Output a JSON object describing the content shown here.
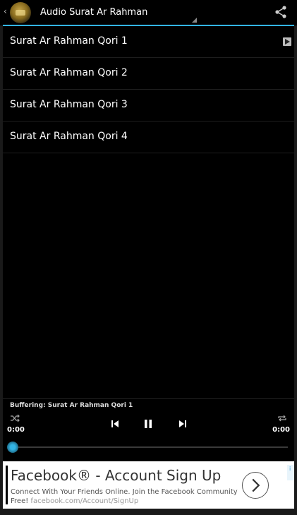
{
  "app": {
    "title": "Audio Surat Ar Rahman",
    "up_glyph": "‹",
    "icons": {
      "logo": "app-logo-icon",
      "share": "share-icon"
    },
    "accent": "#33b5e5"
  },
  "list": {
    "items": [
      {
        "label": "Surat Ar Rahman Qori 1",
        "playing": true
      },
      {
        "label": "Surat Ar Rahman Qori 2",
        "playing": false
      },
      {
        "label": "Surat Ar Rahman Qori 3",
        "playing": false
      },
      {
        "label": "Surat Ar Rahman Qori 4",
        "playing": false
      }
    ]
  },
  "player": {
    "status": "Buffering: Surat Ar Rahman Qori 1",
    "elapsed": "0:00",
    "duration": "0:00",
    "progress": 0,
    "icons": {
      "shuffle": "shuffle-icon",
      "previous": "skip-previous-icon",
      "pause": "pause-icon",
      "next": "skip-next-icon",
      "repeat": "repeat-icon"
    }
  },
  "ad": {
    "headline": "Facebook® - Account Sign Up",
    "body": "Connect With Your Friends Online. Join the Facebook Community Free!",
    "url": "facebook.com/Account/SignUp",
    "icons": {
      "go": "chevron-right-icon",
      "adchoices": "ad-info-icon"
    }
  }
}
